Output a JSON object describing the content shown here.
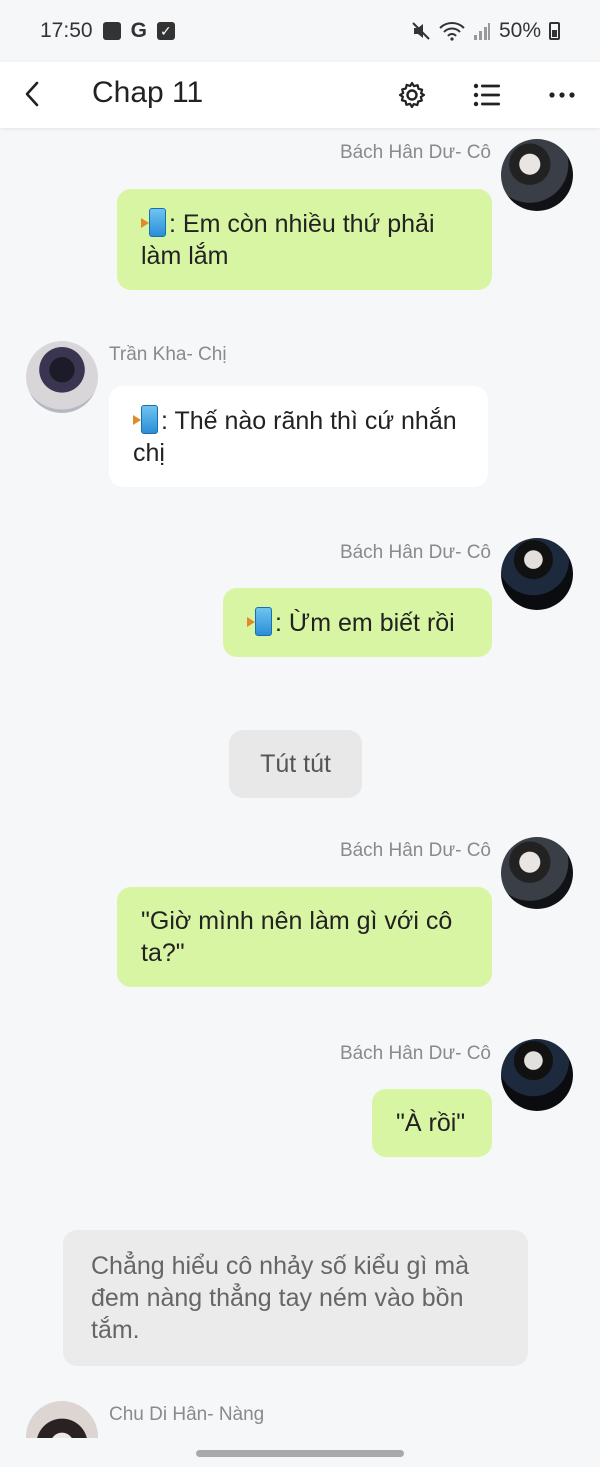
{
  "status_bar": {
    "time": "17:50",
    "g_label": "G",
    "battery": "50%",
    "icons": [
      "image-icon",
      "google-icon",
      "check-icon",
      "mute-icon",
      "wifi-icon",
      "signal-icon",
      "battery-icon"
    ]
  },
  "app_bar": {
    "title": "Chap 11",
    "icons": [
      "back-icon",
      "gear-icon",
      "list-icon",
      "more-icon"
    ]
  },
  "messages": [
    {
      "sender": "Bách Hân Dư- Cô",
      "side": "right",
      "phone": true,
      "text": ": Em còn nhiều thứ phải làm lắm"
    },
    {
      "sender": "Trần Kha- Chị",
      "side": "left",
      "phone": true,
      "text": ": Thế nào rãnh thì cứ nhắn chị"
    },
    {
      "sender": "Bách Hân Dư- Cô",
      "side": "right",
      "phone": true,
      "text": ": Ừm em biết rồi"
    },
    {
      "sender": "",
      "side": "center",
      "phone": false,
      "text": "Tút tút"
    },
    {
      "sender": "Bách Hân Dư- Cô",
      "side": "right",
      "phone": false,
      "text": "\"Giờ mình nên làm gì với cô ta?\""
    },
    {
      "sender": "Bách Hân Dư- Cô",
      "side": "right",
      "phone": false,
      "text": "\"À rồi\""
    },
    {
      "sender": "",
      "side": "narration",
      "phone": false,
      "text": "Chẳng hiểu cô nhảy số kiểu gì mà đem nàng thẳng tay ném vào bồn tắm."
    },
    {
      "sender": "Chu Di Hân- Nàng",
      "side": "left",
      "phone": false,
      "text": ""
    }
  ],
  "colors": {
    "bubble_green": "#d8f5a3",
    "bubble_white": "#ffffff",
    "background": "#f6f7f9",
    "name_grey": "#8a8a8a"
  }
}
